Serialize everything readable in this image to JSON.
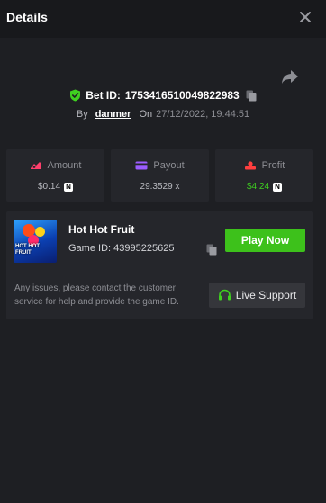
{
  "header": {
    "title": "Details",
    "close_icon": "close-icon"
  },
  "bet": {
    "bet_id_label": "Bet ID:",
    "bet_id": "1753416510049822983",
    "by_label": "By",
    "user": "danmer",
    "on_label": "On",
    "date": "27/12/2022, 19:44:51",
    "verified_color": "#3fcf20"
  },
  "stats": {
    "amount": {
      "label": "Amount",
      "value": "$0.14",
      "coin": "N",
      "icon": "money-icon",
      "icon_color": "#ff3f6c"
    },
    "payout": {
      "label": "Payout",
      "value": "29.3529 x",
      "icon": "card-icon",
      "icon_color": "#9b5cff"
    },
    "profit": {
      "label": "Profit",
      "value": "$4.24",
      "coin": "N",
      "icon": "coins-icon",
      "icon_color": "#ff3f3f",
      "value_color": "#3fcf20"
    }
  },
  "game": {
    "name": "Hot Hot Fruit",
    "id_label": "Game ID:",
    "id": "43995225625",
    "thumb_text": "HOT HOT FRUIT",
    "play_label": "Play Now",
    "play_color": "#3dc11b",
    "help_text": "Any issues, please contact the customer service for help and provide the game ID.",
    "support_label": "Live Support",
    "support_icon": "headset-icon"
  }
}
